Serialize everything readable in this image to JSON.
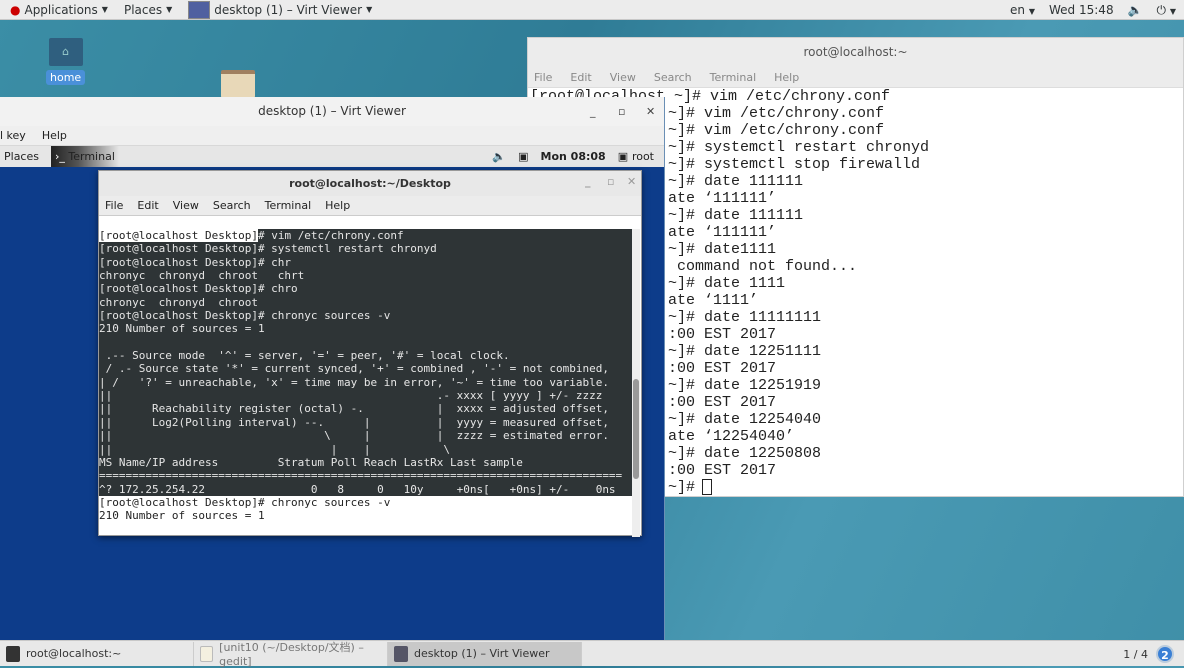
{
  "topbar": {
    "applications": "Applications",
    "places": "Places",
    "window": "desktop (1) – Virt Viewer",
    "lang": "en",
    "clock": "Wed 15:48"
  },
  "desktop": {
    "home_label": "home"
  },
  "right_terminal": {
    "title": "root@localhost:~",
    "menu": [
      "File",
      "Edit",
      "View",
      "Search",
      "Terminal",
      "Help"
    ],
    "lines": [
      "[root@localhost ~]# vim /etc/chrony.conf",
      "~]# vim /etc/chrony.conf",
      "~]# vim /etc/chrony.conf",
      "~]# systemctl restart chronyd",
      "~]# systemctl stop firewalld",
      "~]# date 111111",
      "ate ‘111111’",
      "~]# date 111111",
      "ate ‘111111’",
      "~]# date1111",
      " command not found...",
      "~]# date 1111",
      "ate ‘1111’",
      "~]# date 11111111",
      ":00 EST 2017",
      "~]# date 12251111",
      ":00 EST 2017",
      "~]# date 12251919",
      ":00 EST 2017",
      "~]# date 12254040",
      "ate ‘12254040’",
      "~]# date 12250808",
      ":00 EST 2017",
      "~]# "
    ]
  },
  "virt_viewer": {
    "title": "desktop (1) – Virt Viewer",
    "menu": [
      "l key",
      "Help"
    ],
    "guest_bar": {
      "places": "Places",
      "terminal": "Terminal",
      "clock": "Mon 08:08",
      "user": "root"
    }
  },
  "inner_terminal": {
    "title": "root@localhost:~/Desktop",
    "menu": [
      "File",
      "Edit",
      "View",
      "Search",
      "Terminal",
      "Help"
    ],
    "prompt": "[root@localhost Desktop]",
    "lines": [
      "# vim /etc/chrony.conf",
      "[root@localhost Desktop]# systemctl restart chronyd",
      "[root@localhost Desktop]# chr",
      "chronyc  chronyd  chroot   chrt",
      "[root@localhost Desktop]# chro",
      "chronyc  chronyd  chroot",
      "[root@localhost Desktop]# chronyc sources -v",
      "210 Number of sources = 1",
      "",
      " .-- Source mode  '^' = server, '=' = peer, '#' = local clock.",
      " / .- Source state '*' = current synced, '+' = combined , '-' = not combined,",
      "| /   '?' = unreachable, 'x' = time may be in error, '~' = time too variable.",
      "||                                                 .- xxxx [ yyyy ] +/- zzzz",
      "||      Reachability register (octal) -.           |  xxxx = adjusted offset,",
      "||      Log2(Polling interval) --.      |          |  yyyy = measured offset,",
      "||                                \\     |          |  zzzz = estimated error.",
      "||                                 |    |           \\",
      "MS Name/IP address         Stratum Poll Reach LastRx Last sample",
      "===============================================================================",
      "^? 172.25.254.22                0   8     0   10y     +0ns[   +0ns] +/-    0ns"
    ],
    "after_lines": [
      "[root@localhost Desktop]# chronyc sources -v",
      "210 Number of sources = 1"
    ]
  },
  "taskbar": {
    "items": [
      "root@localhost:~",
      "[unit10 (~/Desktop/文档) – gedit]",
      "desktop (1) – Virt Viewer"
    ],
    "workspace": "1 / 4",
    "badge": "2"
  }
}
